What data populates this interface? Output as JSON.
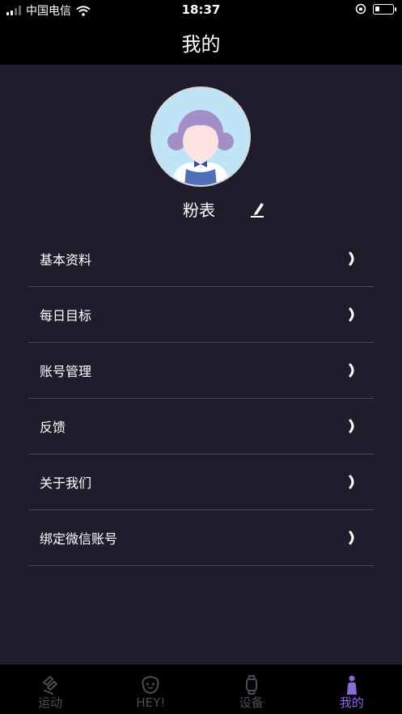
{
  "status_bar": {
    "carrier": "中国电信",
    "time": "18:37"
  },
  "header": {
    "title": "我的"
  },
  "profile": {
    "username": "粉表"
  },
  "menu": {
    "items": [
      {
        "label": "基本资料"
      },
      {
        "label": "每日目标"
      },
      {
        "label": "账号管理"
      },
      {
        "label": "反馈"
      },
      {
        "label": "关于我们"
      },
      {
        "label": "绑定微信账号"
      }
    ]
  },
  "tab_bar": {
    "tabs": [
      {
        "label": "运动",
        "icon": "sport-icon"
      },
      {
        "label": "HEY!",
        "icon": "hey-face-icon"
      },
      {
        "label": "设备",
        "icon": "watch-icon"
      },
      {
        "label": "我的",
        "icon": "person-icon"
      }
    ],
    "active_color": "#8a6ad6",
    "inactive_color": "#4c4c56"
  },
  "colors": {
    "background": "#1f1d2b",
    "header": "#000000",
    "divider": "#4a4759"
  }
}
